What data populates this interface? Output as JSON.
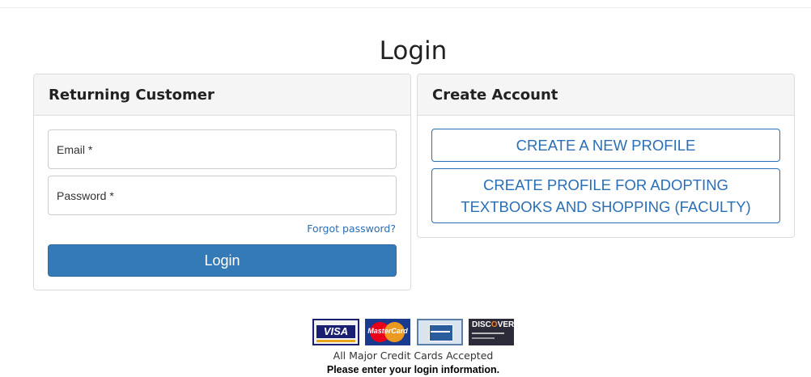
{
  "page": {
    "title": "Login"
  },
  "returning_customer": {
    "heading": "Returning Customer",
    "email_placeholder": "Email *",
    "password_placeholder": "Password *",
    "forgot_password": "Forgot password?",
    "login_button": "Login"
  },
  "create_account": {
    "heading": "Create Account",
    "create_profile_button": "CREATE A NEW PROFILE",
    "create_faculty_button": "CREATE PROFILE FOR ADOPTING TEXTBOOKS AND SHOPPING (FACULTY)"
  },
  "payment": {
    "cards": [
      "visa",
      "mastercard",
      "american-express",
      "discover"
    ],
    "visa_label": "VISA",
    "mastercard_label": "MasterCard",
    "discover_label_1": "DISC",
    "discover_label_2": "O",
    "discover_label_3": "VER",
    "caption": "All Major Credit Cards Accepted"
  },
  "message": "Please enter your login information.",
  "colors": {
    "primary": "#337ab7",
    "link": "#2a6fb6",
    "panel_heading_bg": "#f5f5f5",
    "border": "#dcdcdc"
  }
}
